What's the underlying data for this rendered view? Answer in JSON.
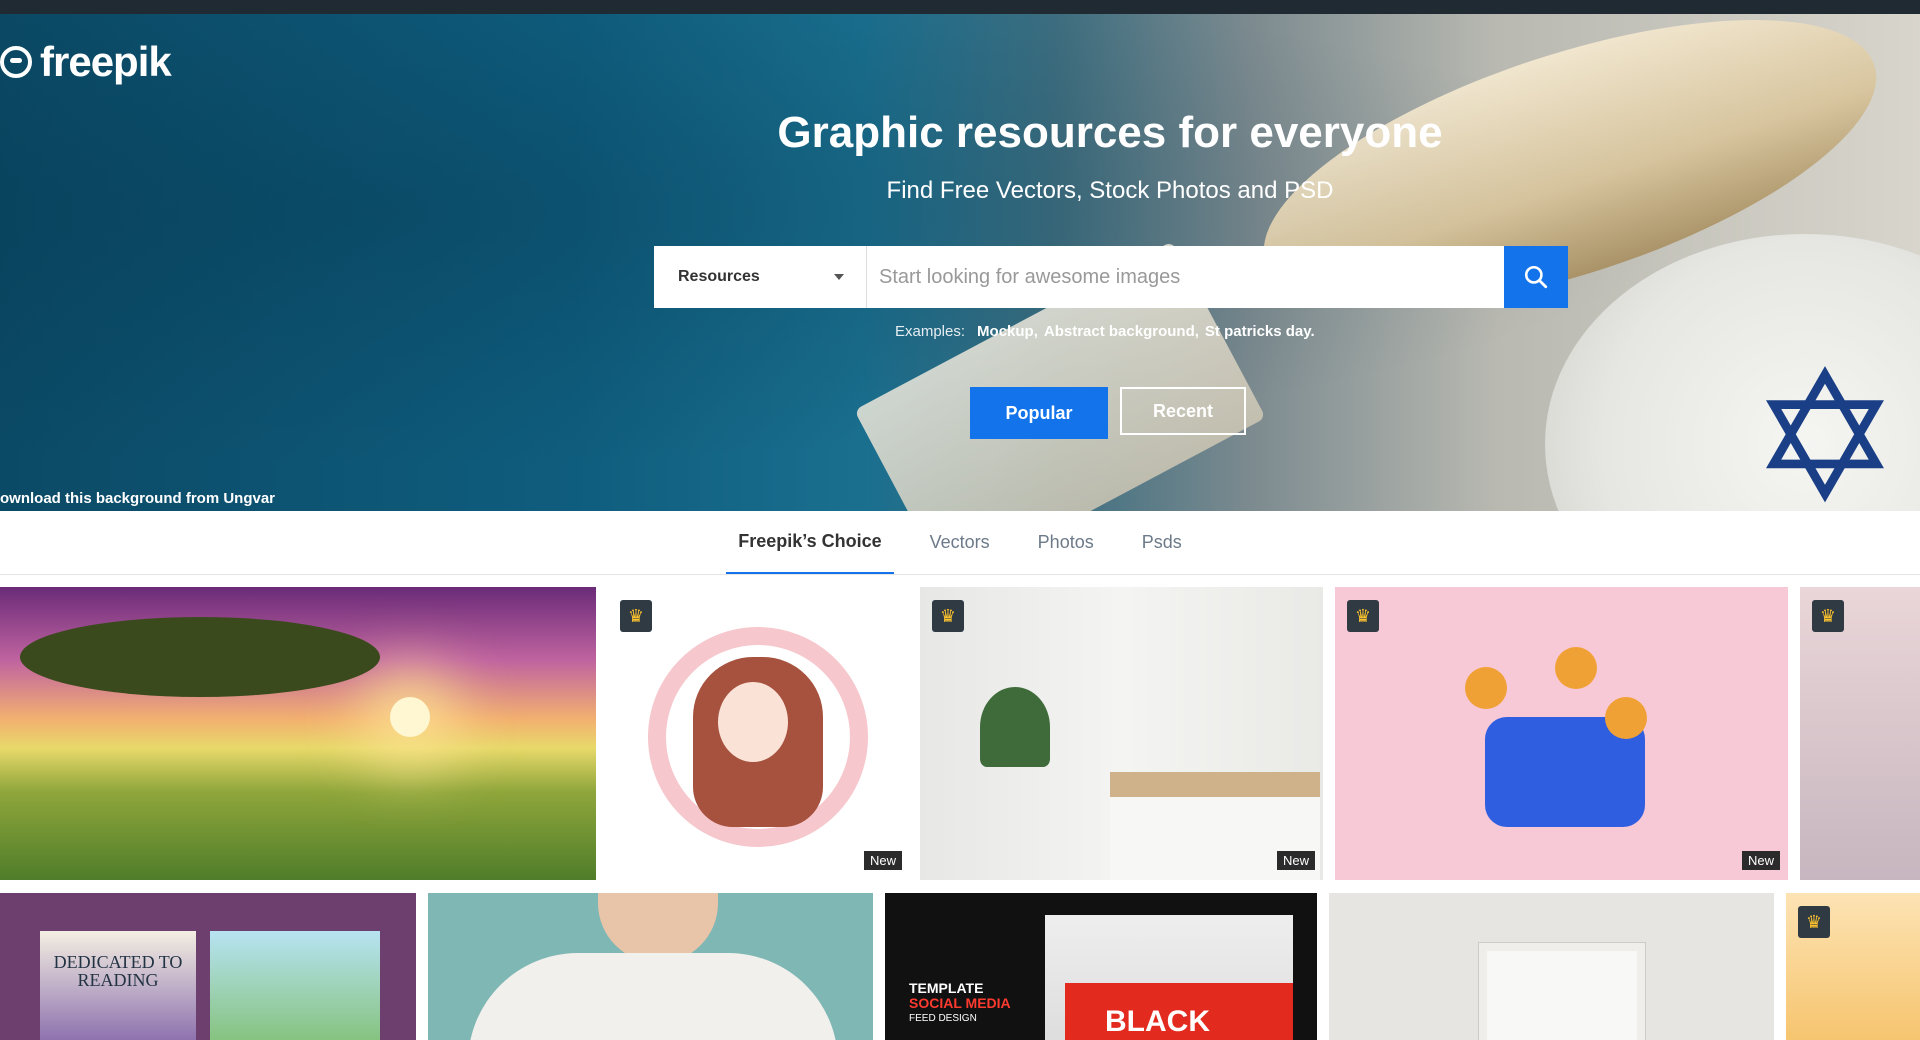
{
  "brand": {
    "name": "freepik"
  },
  "hero": {
    "title": "Graphic resources for everyone",
    "subtitle": "Find Free Vectors, Stock Photos and PSD",
    "search": {
      "category": "Resources",
      "placeholder": "Start looking for awesome images"
    },
    "examples": {
      "label": "Examples:",
      "items": [
        "Mockup,",
        "Abstract background,",
        "St patricks day."
      ]
    },
    "buttons": {
      "popular": "Popular",
      "recent": "Recent"
    },
    "credit": "ownload this background from Ungvar"
  },
  "tabs": [
    "Freepik’s Choice",
    "Vectors",
    "Photos",
    "Psds"
  ],
  "badges": {
    "new": "New"
  },
  "thumbs": {
    "book": "DEDICATED TO READING",
    "social": {
      "line1": "TEMPLATE",
      "line2": "SOCIAL MEDIA",
      "line3": "FEED DESIGN",
      "big": "BLACK"
    }
  },
  "colors": {
    "accent": "#1273eb",
    "topbar": "#1f2a33",
    "premium_badge": "#ffc42d"
  }
}
